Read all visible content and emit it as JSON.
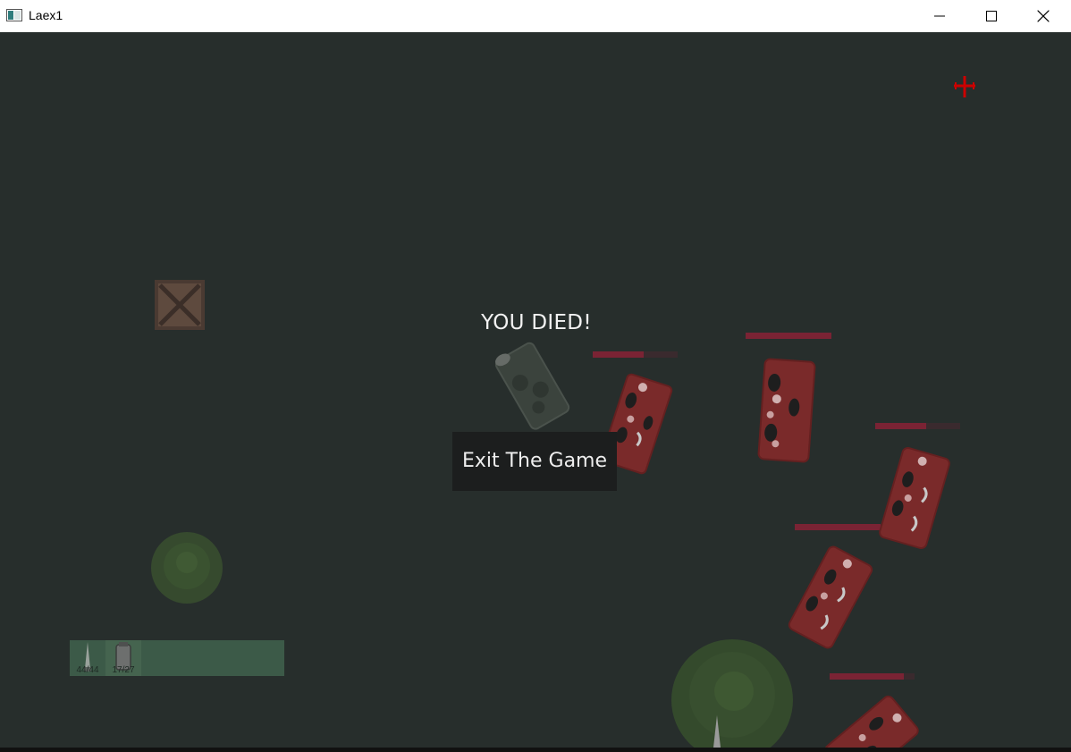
{
  "window": {
    "title": "Laex1",
    "minimize_label": "Minimize",
    "maximize_label": "Maximize",
    "close_label": "Close"
  },
  "game": {
    "death_message": "YOU DIED!",
    "exit_button_label": "Exit The Game",
    "hotbar": {
      "slots": [
        {
          "icon": "knife-icon",
          "count": "44/44"
        },
        {
          "icon": "grenade-icon",
          "count": "17/27"
        }
      ]
    },
    "colors": {
      "background": "#272e2c",
      "health_bar": "#7a2334",
      "zombie": "#7a2a2a",
      "crosshair": "#cc0000"
    },
    "enemy_health_fractions": [
      0.6,
      1.0,
      0.6,
      1.0,
      0.87
    ]
  }
}
